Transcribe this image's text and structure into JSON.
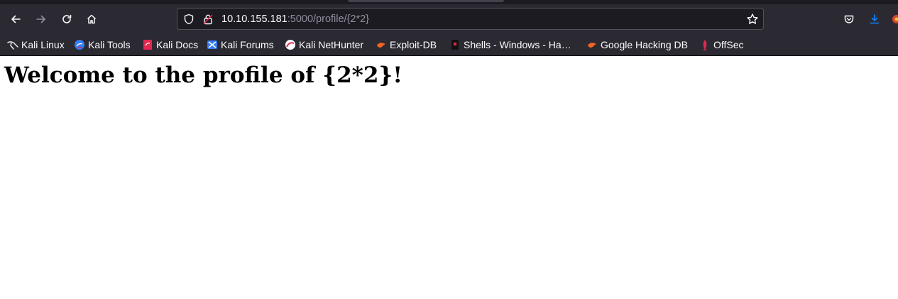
{
  "browser": {
    "url_host": "10.10.155.181",
    "url_rest": ":5000/profile/{2*2}",
    "icons": [
      "back-icon",
      "forward-icon",
      "reload-icon",
      "home-icon",
      "shield-icon",
      "lock-icon",
      "star-icon",
      "pocket-icon",
      "download-icon",
      "extension-icon"
    ],
    "colors": {
      "chrome_bg": "#2b2a33",
      "urlbar_bg": "#1c1b22",
      "download_blue": "#0a84ff"
    }
  },
  "bookmarks": [
    {
      "label": "Kali Linux",
      "icon": "kali-dragon-icon"
    },
    {
      "label": "Kali Tools",
      "icon": "kali-tools-icon"
    },
    {
      "label": "Kali Docs",
      "icon": "kali-docs-icon"
    },
    {
      "label": "Kali Forums",
      "icon": "kali-forums-icon"
    },
    {
      "label": "Kali NetHunter",
      "icon": "nethunter-icon"
    },
    {
      "label": "Exploit-DB",
      "icon": "exploit-db-icon"
    },
    {
      "label": "Shells - Windows - Ha…",
      "icon": "shells-icon"
    },
    {
      "label": "Google Hacking DB",
      "icon": "ghdb-icon"
    },
    {
      "label": "OffSec",
      "icon": "offsec-icon"
    }
  ],
  "page": {
    "heading": "Welcome to the profile of {2*2}!"
  }
}
